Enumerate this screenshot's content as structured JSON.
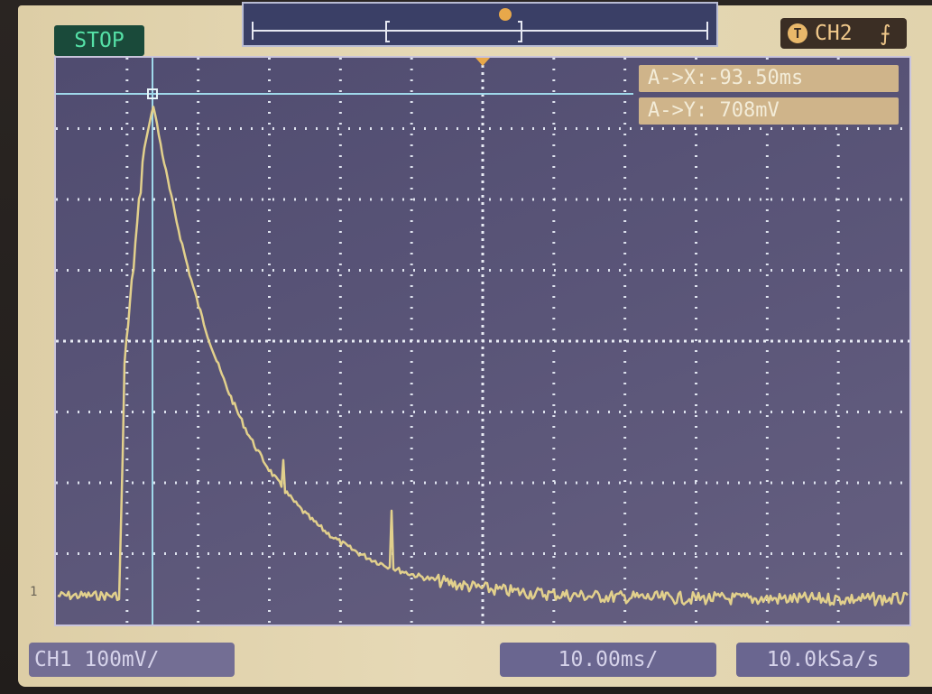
{
  "status": {
    "run_state": "STOP"
  },
  "trigger": {
    "icon_letter": "T",
    "source": "CH2",
    "edge": "rising-edge-icon"
  },
  "cursor": {
    "x_readout": "A->X:-93.50ms",
    "y_readout": "A->Y: 708mV"
  },
  "channel_marker": "1",
  "bottom": {
    "channel_scale": "CH1 100mV/",
    "timebase": "10.00ms/",
    "sample_rate": "10.0kSa/s"
  },
  "colors": {
    "trace": "#e2d08c",
    "grid": "#dfe3ef",
    "cursor": "#9fd8ea",
    "trigger_marker": "#e8a84a",
    "screen_bg": "#575275"
  }
}
